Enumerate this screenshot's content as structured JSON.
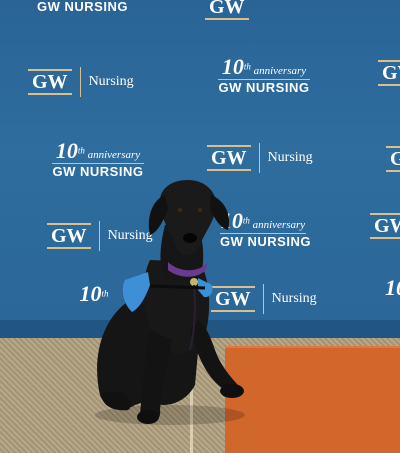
{
  "backdrop": {
    "gw_mark": "GW",
    "nursing_word": "Nursing",
    "anniversary": {
      "number": "10",
      "ordinal": "th",
      "word": "anniversary",
      "wordmark": "GW NURSING"
    },
    "top_banner": "GW NURSING"
  },
  "colors": {
    "backdrop_blue": "#2e6d9e",
    "gold_accent": "#d9c08a",
    "dog_black": "#141414",
    "vest_blue": "#3d8fd6",
    "collar_purple": "#6a3b8f",
    "mat_orange": "#d2672b",
    "carpet_tan": "#b8a88a"
  }
}
